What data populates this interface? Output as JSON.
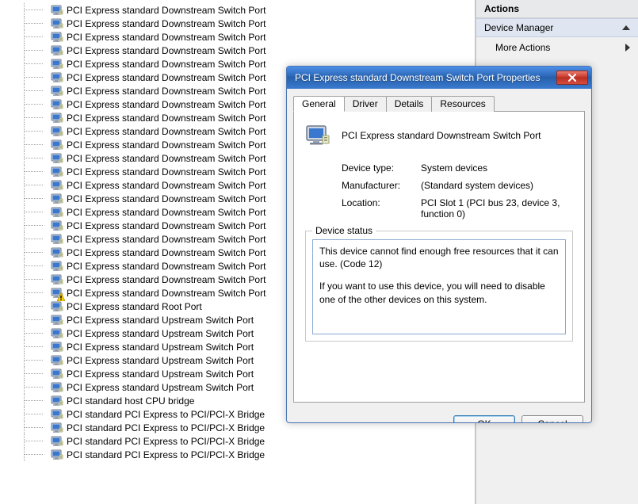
{
  "right_panel": {
    "header": "Actions",
    "section": "Device Manager",
    "item": "More Actions"
  },
  "tree_items": [
    {
      "label": "PCI Express standard Downstream Switch Port",
      "warn": false
    },
    {
      "label": "PCI Express standard Downstream Switch Port",
      "warn": false
    },
    {
      "label": "PCI Express standard Downstream Switch Port",
      "warn": false
    },
    {
      "label": "PCI Express standard Downstream Switch Port",
      "warn": false
    },
    {
      "label": "PCI Express standard Downstream Switch Port",
      "warn": false
    },
    {
      "label": "PCI Express standard Downstream Switch Port",
      "warn": false
    },
    {
      "label": "PCI Express standard Downstream Switch Port",
      "warn": false
    },
    {
      "label": "PCI Express standard Downstream Switch Port",
      "warn": false
    },
    {
      "label": "PCI Express standard Downstream Switch Port",
      "warn": false
    },
    {
      "label": "PCI Express standard Downstream Switch Port",
      "warn": false
    },
    {
      "label": "PCI Express standard Downstream Switch Port",
      "warn": false
    },
    {
      "label": "PCI Express standard Downstream Switch Port",
      "warn": false
    },
    {
      "label": "PCI Express standard Downstream Switch Port",
      "warn": false
    },
    {
      "label": "PCI Express standard Downstream Switch Port",
      "warn": false
    },
    {
      "label": "PCI Express standard Downstream Switch Port",
      "warn": false
    },
    {
      "label": "PCI Express standard Downstream Switch Port",
      "warn": false
    },
    {
      "label": "PCI Express standard Downstream Switch Port",
      "warn": false
    },
    {
      "label": "PCI Express standard Downstream Switch Port",
      "warn": false
    },
    {
      "label": "PCI Express standard Downstream Switch Port",
      "warn": false
    },
    {
      "label": "PCI Express standard Downstream Switch Port",
      "warn": false
    },
    {
      "label": "PCI Express standard Downstream Switch Port",
      "warn": false
    },
    {
      "label": "PCI Express standard Downstream Switch Port",
      "warn": true
    },
    {
      "label": "PCI Express standard Root Port",
      "warn": false
    },
    {
      "label": "PCI Express standard Upstream Switch Port",
      "warn": false
    },
    {
      "label": "PCI Express standard Upstream Switch Port",
      "warn": false
    },
    {
      "label": "PCI Express standard Upstream Switch Port",
      "warn": false
    },
    {
      "label": "PCI Express standard Upstream Switch Port",
      "warn": false
    },
    {
      "label": "PCI Express standard Upstream Switch Port",
      "warn": false
    },
    {
      "label": "PCI Express standard Upstream Switch Port",
      "warn": false
    },
    {
      "label": "PCI standard host CPU bridge",
      "warn": false
    },
    {
      "label": "PCI standard PCI Express to PCI/PCI-X Bridge",
      "warn": false
    },
    {
      "label": "PCI standard PCI Express to PCI/PCI-X Bridge",
      "warn": false
    },
    {
      "label": "PCI standard PCI Express to PCI/PCI-X Bridge",
      "warn": false
    },
    {
      "label": "PCI standard PCI Express to PCI/PCI-X Bridge",
      "warn": false
    }
  ],
  "dialog": {
    "title": "PCI Express standard Downstream Switch Port Properties",
    "tabs": [
      "General",
      "Driver",
      "Details",
      "Resources"
    ],
    "active_tab": 0,
    "device_name": "PCI Express standard Downstream Switch Port",
    "rows": {
      "type_label": "Device type:",
      "type_value": "System devices",
      "mfr_label": "Manufacturer:",
      "mfr_value": "(Standard system devices)",
      "loc_label": "Location:",
      "loc_value": "PCI Slot 1 (PCI bus 23, device 3, function 0)"
    },
    "status_label": "Device status",
    "status_text_1": "This device cannot find enough free resources that it can use. (Code 12)",
    "status_text_2": "If you want to use this device, you will need to disable one of the other devices on this system.",
    "ok_label": "OK",
    "cancel_label": "Cancel"
  }
}
